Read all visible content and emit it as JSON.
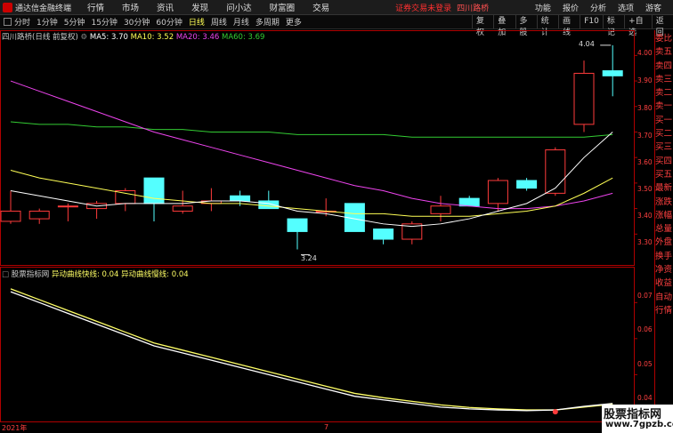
{
  "menubar": {
    "app_title": "通达信金融终端",
    "items": [
      "行情",
      "市场",
      "资讯",
      "发现",
      "问小达",
      "财富圈",
      "交易"
    ],
    "notice": "证券交易未登录",
    "stock_name": "四川路桥",
    "right_items": [
      "功能",
      "报价",
      "分析",
      "选项",
      "游客"
    ]
  },
  "toolbar": {
    "periods": [
      "分时",
      "1分钟",
      "5分钟",
      "15分钟",
      "30分钟",
      "60分钟",
      "日线",
      "周线",
      "月线",
      "多周期",
      "更多"
    ],
    "active_period": "日线",
    "right_buttons": [
      "复权",
      "叠加",
      "多股",
      "统计",
      "画线",
      "F10",
      "标记",
      "+自选",
      "返回"
    ]
  },
  "main_legend": {
    "title": "四川路桥(日线 前复权)",
    "ma5_label": "MA5: 3.70",
    "ma10_label": "MA10: 3.52",
    "ma20_label": "MA20: 3.46",
    "ma60_label": "MA60: 3.69"
  },
  "indicator_legend": {
    "title": "股票指标网",
    "fast_label": "异动曲线快线: 0.04",
    "slow_label": "异动曲线慢线: 0.04"
  },
  "price_axis": [
    "4.00",
    "3.90",
    "3.80",
    "3.70",
    "3.60",
    "3.50",
    "3.40",
    "3.30"
  ],
  "indicator_axis": [
    "0.07",
    "0.06",
    "0.05",
    "0.04"
  ],
  "annotations": {
    "high": "4.04",
    "low": "3.24"
  },
  "side_panel": [
    "委比",
    "卖五",
    "卖四",
    "卖三",
    "卖二",
    "卖一",
    "买一",
    "买二",
    "买三",
    "买四",
    "买五",
    "最新",
    "涨跌",
    "涨幅",
    "总量",
    "外盘",
    "换手",
    "净资",
    "收益",
    "自动",
    "行情"
  ],
  "time_axis": {
    "start": "2021年",
    "mid": "7"
  },
  "watermark": {
    "line1": "股票指标网",
    "line2": "www.7gpzb.com"
  },
  "chart_data": {
    "type": "candlestick",
    "ylim": [
      3.2,
      4.05
    ],
    "candles": [
      {
        "o": 3.35,
        "h": 3.47,
        "l": 3.34,
        "c": 3.39
      },
      {
        "o": 3.36,
        "h": 3.4,
        "l": 3.34,
        "c": 3.39
      },
      {
        "o": 3.41,
        "h": 3.42,
        "l": 3.35,
        "c": 3.41
      },
      {
        "o": 3.4,
        "h": 3.43,
        "l": 3.36,
        "c": 3.42
      },
      {
        "o": 3.42,
        "h": 3.48,
        "l": 3.39,
        "c": 3.47
      },
      {
        "o": 3.52,
        "h": 3.52,
        "l": 3.35,
        "c": 3.42
      },
      {
        "o": 3.39,
        "h": 3.47,
        "l": 3.38,
        "c": 3.41
      },
      {
        "o": 3.42,
        "h": 3.48,
        "l": 3.39,
        "c": 3.43
      },
      {
        "o": 3.45,
        "h": 3.47,
        "l": 3.41,
        "c": 3.43
      },
      {
        "o": 3.43,
        "h": 3.47,
        "l": 3.4,
        "c": 3.4
      },
      {
        "o": 3.36,
        "h": 3.36,
        "l": 3.24,
        "c": 3.31
      },
      {
        "o": 3.39,
        "h": 3.44,
        "l": 3.37,
        "c": 3.39
      },
      {
        "o": 3.42,
        "h": 3.42,
        "l": 3.31,
        "c": 3.31
      },
      {
        "o": 3.32,
        "h": 3.32,
        "l": 3.26,
        "c": 3.28
      },
      {
        "o": 3.28,
        "h": 3.35,
        "l": 3.26,
        "c": 3.34
      },
      {
        "o": 3.38,
        "h": 3.45,
        "l": 3.35,
        "c": 3.41
      },
      {
        "o": 3.44,
        "h": 3.45,
        "l": 3.41,
        "c": 3.41
      },
      {
        "o": 3.42,
        "h": 3.52,
        "l": 3.39,
        "c": 3.51
      },
      {
        "o": 3.51,
        "h": 3.52,
        "l": 3.47,
        "c": 3.48
      },
      {
        "o": 3.46,
        "h": 3.64,
        "l": 3.45,
        "c": 3.63
      },
      {
        "o": 3.73,
        "h": 3.98,
        "l": 3.7,
        "c": 3.93
      },
      {
        "o": 3.94,
        "h": 4.04,
        "l": 3.84,
        "c": 3.92
      }
    ],
    "ma5": [
      3.47,
      3.45,
      3.43,
      3.41,
      3.42,
      3.42,
      3.42,
      3.43,
      3.43,
      3.42,
      3.39,
      3.38,
      3.36,
      3.34,
      3.33,
      3.34,
      3.36,
      3.39,
      3.42,
      3.48,
      3.6,
      3.7
    ],
    "ma10": [
      3.55,
      3.52,
      3.5,
      3.48,
      3.46,
      3.44,
      3.43,
      3.42,
      3.42,
      3.41,
      3.4,
      3.39,
      3.38,
      3.38,
      3.37,
      3.37,
      3.37,
      3.38,
      3.39,
      3.41,
      3.46,
      3.52
    ],
    "ma20": [
      3.9,
      3.86,
      3.82,
      3.78,
      3.74,
      3.7,
      3.67,
      3.64,
      3.61,
      3.58,
      3.55,
      3.52,
      3.49,
      3.47,
      3.44,
      3.42,
      3.41,
      3.4,
      3.4,
      3.41,
      3.43,
      3.46
    ],
    "ma60": [
      3.74,
      3.73,
      3.73,
      3.72,
      3.72,
      3.71,
      3.71,
      3.7,
      3.7,
      3.7,
      3.69,
      3.69,
      3.69,
      3.69,
      3.68,
      3.68,
      3.68,
      3.68,
      3.68,
      3.68,
      3.68,
      3.69
    ],
    "indicator": {
      "ylim": [
        0.038,
        0.076
      ],
      "fast": [
        0.073,
        0.07,
        0.067,
        0.064,
        0.061,
        0.058,
        0.056,
        0.054,
        0.052,
        0.05,
        0.048,
        0.046,
        0.044,
        0.043,
        0.042,
        0.041,
        0.0405,
        0.0402,
        0.04,
        0.0402,
        0.0412,
        0.042
      ],
      "slow": [
        0.0738,
        0.0708,
        0.0678,
        0.0648,
        0.0618,
        0.0588,
        0.0568,
        0.0548,
        0.0528,
        0.0508,
        0.0488,
        0.0468,
        0.0448,
        0.0436,
        0.0426,
        0.0416,
        0.0409,
        0.0405,
        0.0402,
        0.0402,
        0.041,
        0.0418
      ]
    }
  },
  "colors": {
    "up": "#ff3b3b",
    "down": "#54ffff",
    "ma5": "#ffffff",
    "ma10": "#ffff55",
    "ma20": "#ee44ee",
    "ma60": "#33cc33",
    "axis": "#b00000",
    "fast": "#ffffff",
    "slow": "#ffff66"
  }
}
